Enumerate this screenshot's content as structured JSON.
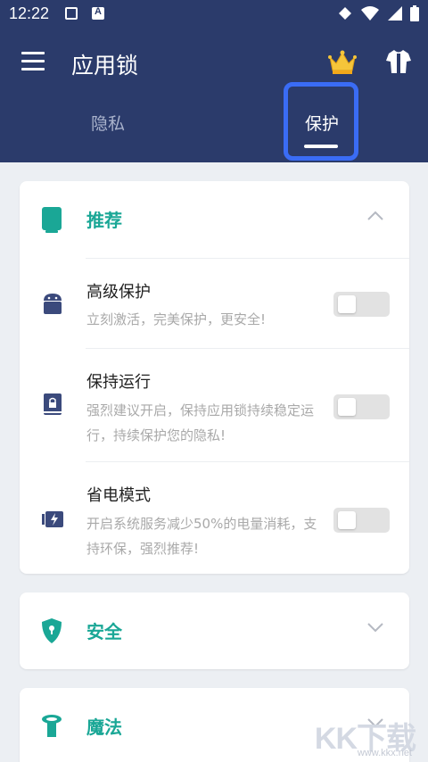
{
  "status": {
    "time": "12:22"
  },
  "appbar": {
    "title": "应用锁"
  },
  "tabs": [
    {
      "label": "隐私"
    },
    {
      "label": "保护"
    }
  ],
  "recommend": {
    "label": "推荐",
    "items": [
      {
        "title": "高级保护",
        "desc": "立刻激活，完美保护，更安全!",
        "enabled": false
      },
      {
        "title": "保持运行",
        "desc": "强烈建议开启，保持应用锁持续稳定运行，持续保护您的隐私!",
        "enabled": false
      },
      {
        "title": "省电模式",
        "desc": "开启系统服务减少50%的电量消耗，支持环保，强烈推荐!",
        "enabled": false
      }
    ]
  },
  "security": {
    "label": "安全"
  },
  "magic": {
    "label": "魔法"
  },
  "watermark": {
    "brand": "KK下载",
    "url": "www.kkx.net"
  },
  "colors": {
    "header_bg": "#2b3b6b",
    "accent": "#1aa796",
    "highlight": "#3a6cf5",
    "icon_navy": "#3b4a7c"
  }
}
